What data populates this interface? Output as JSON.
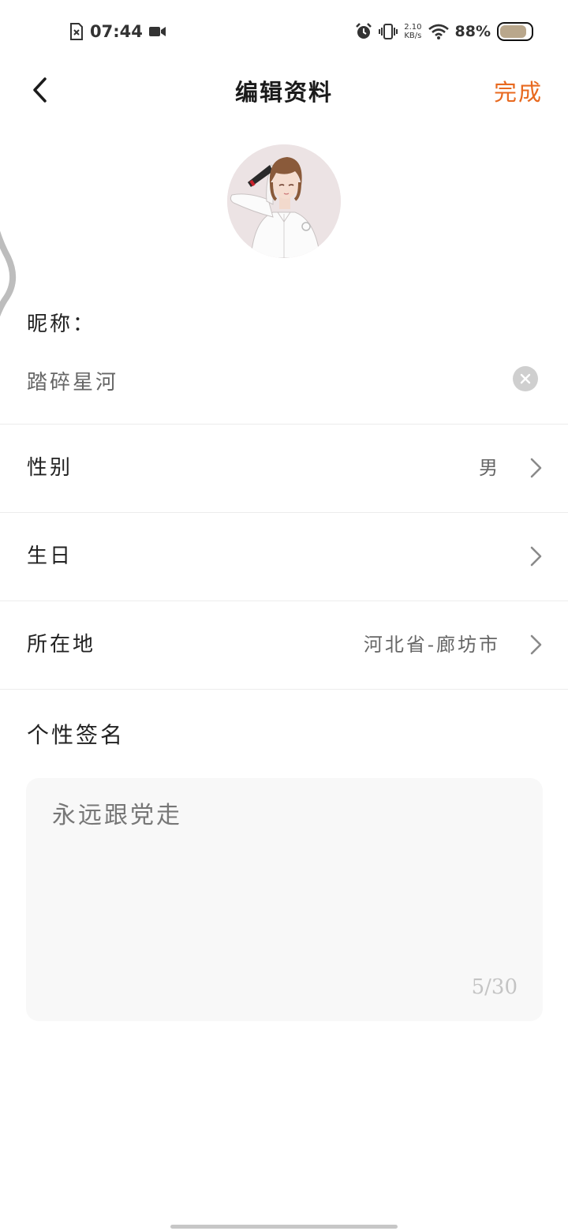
{
  "status_bar": {
    "time": "07:44",
    "net_speed_value": "2.10",
    "net_speed_unit": "KB/s",
    "battery_percent": "88%",
    "battery_level": 0.88,
    "icons": [
      "sim-missing-icon",
      "video-camera-icon",
      "alarm-icon",
      "vibrate-icon",
      "wifi-icon",
      "battery-icon"
    ]
  },
  "header": {
    "title": "编辑资料",
    "done_label": "完成",
    "accent_color": "#e8691f"
  },
  "profile": {
    "nickname_label": "昵称：",
    "nickname_value": "踏碎星河",
    "fields": [
      {
        "label": "性别",
        "value": "男"
      },
      {
        "label": "生日",
        "value": ""
      },
      {
        "label": "所在地",
        "value": "河北省-廊坊市"
      }
    ],
    "signature_label": "个性签名",
    "signature_value": "永远跟党走",
    "signature_count": "5/30"
  }
}
